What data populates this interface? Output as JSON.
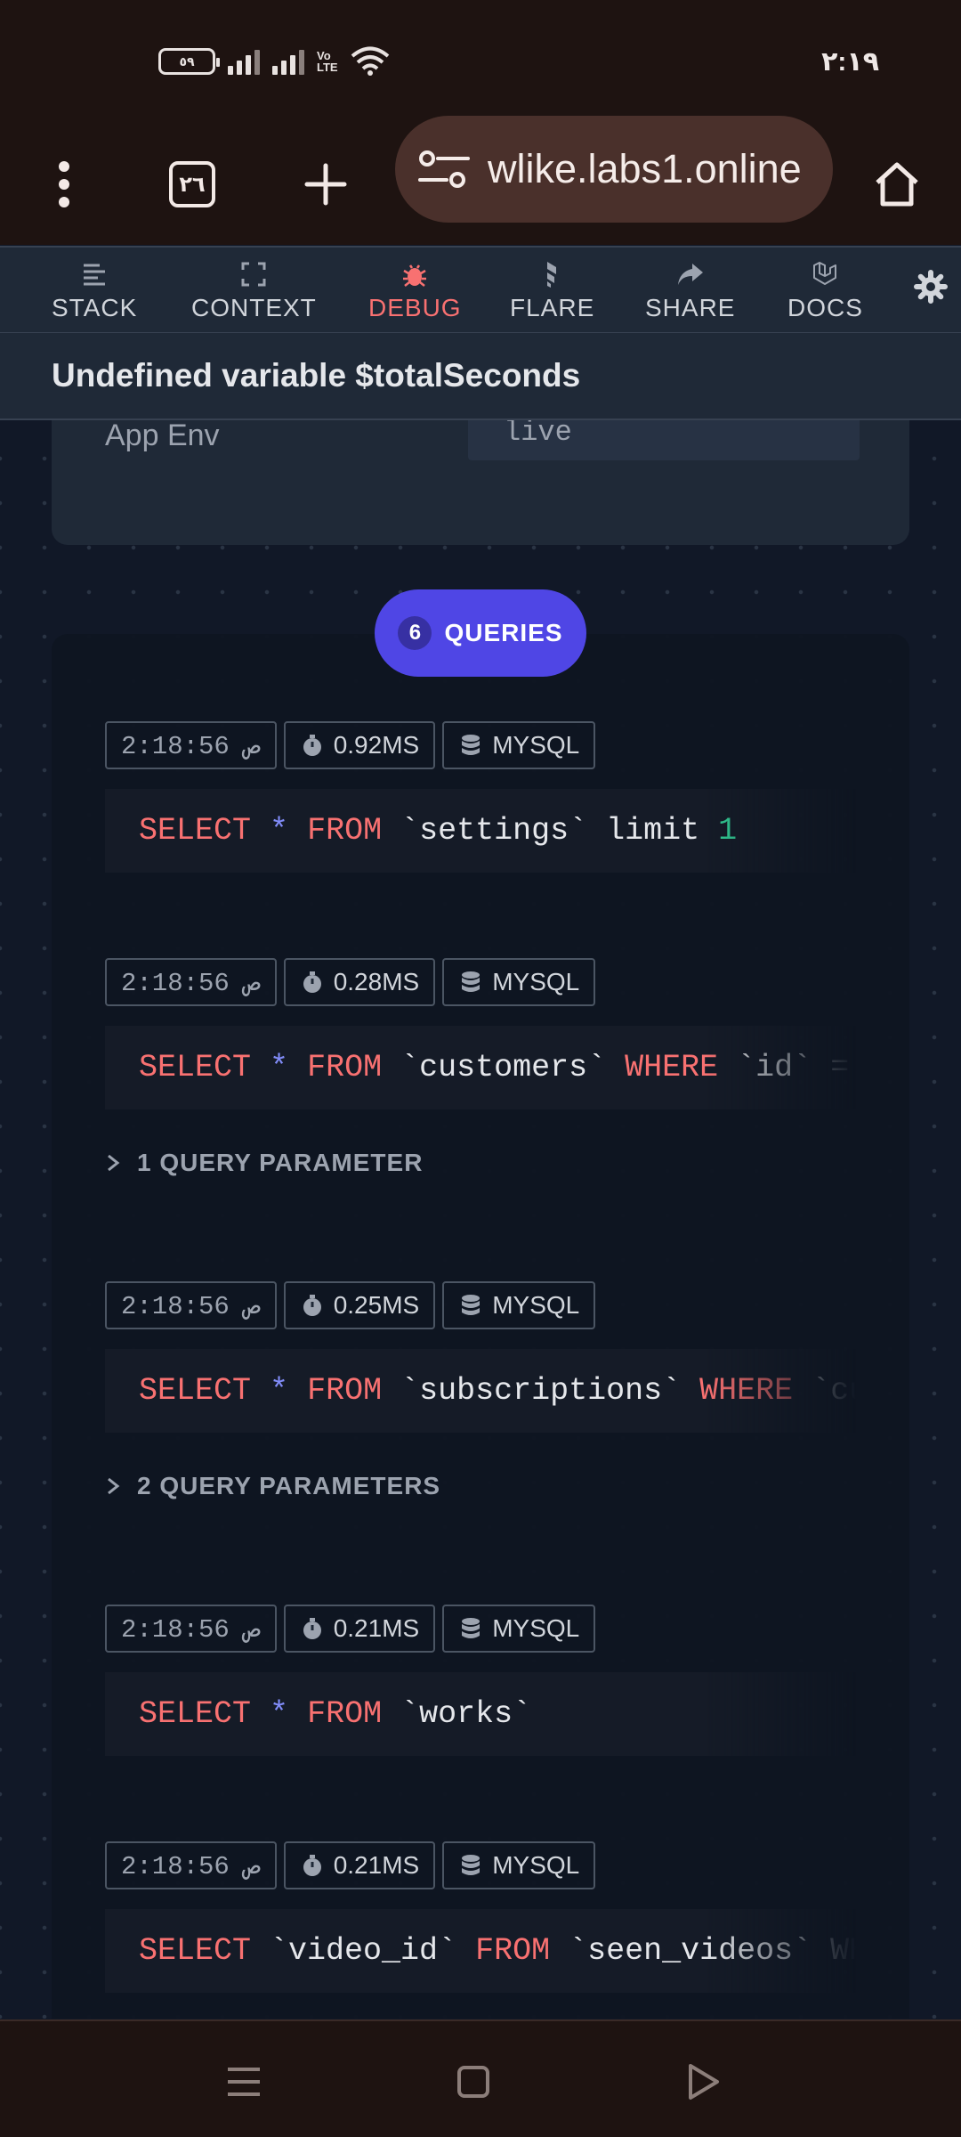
{
  "status_bar": {
    "battery": "٥٩",
    "volte": "Vo\nLTE",
    "clock": "٢:١٩"
  },
  "browser": {
    "tab_count": "٢٦",
    "url": "wlike.labs1.online"
  },
  "nav": {
    "items": [
      {
        "label": "STACK",
        "icon": "stack-icon"
      },
      {
        "label": "CONTEXT",
        "icon": "context-icon"
      },
      {
        "label": "DEBUG",
        "icon": "bug-icon",
        "active": true
      },
      {
        "label": "FLARE",
        "icon": "flare-icon"
      },
      {
        "label": "SHARE",
        "icon": "share-icon"
      },
      {
        "label": "DOCS",
        "icon": "laravel-icon"
      }
    ],
    "active_color": "#f87171"
  },
  "error": {
    "title": "Undefined variable $totalSeconds"
  },
  "env": {
    "label": "App Env",
    "value": "live"
  },
  "queries": {
    "count": "6",
    "label": "QUERIES",
    "items": [
      {
        "time": "2:18:56 ص",
        "duration": "0.92MS",
        "driver": "MYSQL",
        "sql": [
          [
            "kw",
            "SELECT"
          ],
          [
            "sp",
            " "
          ],
          [
            "star",
            "*"
          ],
          [
            "sp",
            " "
          ],
          [
            "kw",
            "FROM"
          ],
          [
            "ident",
            " `settings` limit "
          ],
          [
            "num",
            "1"
          ]
        ],
        "params": ""
      },
      {
        "time": "2:18:56 ص",
        "duration": "0.28MS",
        "driver": "MYSQL",
        "sql": [
          [
            "kw",
            "SELECT"
          ],
          [
            "sp",
            " "
          ],
          [
            "star",
            "*"
          ],
          [
            "sp",
            " "
          ],
          [
            "kw",
            "FROM"
          ],
          [
            "ident",
            " `customers` "
          ],
          [
            "kw",
            "WHERE"
          ],
          [
            "ident",
            " `id` = ?"
          ]
        ],
        "params": "1 QUERY PARAMETER"
      },
      {
        "time": "2:18:56 ص",
        "duration": "0.25MS",
        "driver": "MYSQL",
        "sql": [
          [
            "kw",
            "SELECT"
          ],
          [
            "sp",
            " "
          ],
          [
            "star",
            "*"
          ],
          [
            "sp",
            " "
          ],
          [
            "kw",
            "FROM"
          ],
          [
            "ident",
            " `subscriptions` "
          ],
          [
            "kw",
            "WHERE"
          ],
          [
            "ident",
            " `customer_id` = ?"
          ]
        ],
        "params": "2 QUERY PARAMETERS"
      },
      {
        "time": "2:18:56 ص",
        "duration": "0.21MS",
        "driver": "MYSQL",
        "sql": [
          [
            "kw",
            "SELECT"
          ],
          [
            "sp",
            " "
          ],
          [
            "star",
            "*"
          ],
          [
            "sp",
            " "
          ],
          [
            "kw",
            "FROM"
          ],
          [
            "ident",
            " `works`"
          ]
        ],
        "params": ""
      },
      {
        "time": "2:18:56 ص",
        "duration": "0.21MS",
        "driver": "MYSQL",
        "sql": [
          [
            "kw",
            "SELECT"
          ],
          [
            "ident",
            " `video_id` "
          ],
          [
            "kw",
            "FROM"
          ],
          [
            "ident",
            " `seen_videos` WHERE"
          ]
        ],
        "params": ""
      }
    ]
  },
  "colors": {
    "keyword": "#f87171",
    "star": "#818cf8",
    "number": "#34d399",
    "badge": "#4f46e5"
  }
}
